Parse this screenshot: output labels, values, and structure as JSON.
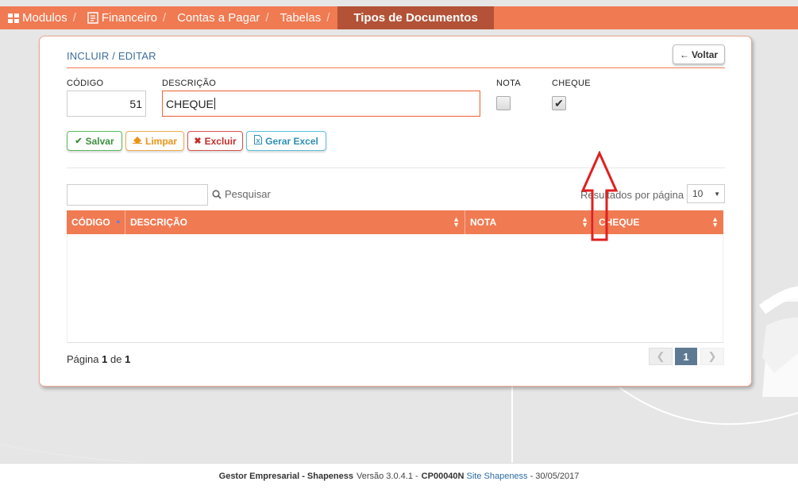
{
  "breadcrumb": {
    "modulos": "Modulos",
    "financeiro": "Financeiro",
    "contas": "Contas a Pagar",
    "tabelas": "Tabelas",
    "current": "Tipos de Documentos",
    "separator": "/"
  },
  "form": {
    "title": "INCLUIR / EDITAR",
    "back_label": "Voltar",
    "codigo_label": "CÓDIGO",
    "codigo_value": "51",
    "descricao_label": "DESCRIÇÃO",
    "descricao_value": "CHEQUE",
    "nota_label": "NOTA",
    "nota_checked": false,
    "cheque_label": "CHEQUE",
    "cheque_checked": true
  },
  "actions": {
    "salvar": "Salvar",
    "limpar": "Limpar",
    "excluir": "Excluir",
    "excel": "Gerar Excel"
  },
  "table": {
    "search_label": "Pesquisar",
    "search_value": "",
    "page_size_label": "Resultados por página",
    "page_size": "10",
    "columns": [
      "CÓDIGO",
      "DESCRIÇÃO",
      "NOTA",
      "CHEQUE"
    ],
    "rows": []
  },
  "pager": {
    "prefix": "Página",
    "page": "1",
    "of": "de",
    "total": "1",
    "current_button": "1"
  },
  "footer": {
    "product": "Gestor Empresarial - Shapeness",
    "version": "Versão 3.0.4.1 -",
    "code": "CP00040N",
    "link": "Site Shapeness",
    "date": "- 30/05/2017"
  },
  "colors": {
    "accent": "#f07a52",
    "breadcrumb_active": "#b35236",
    "annotation_arrow": "#e02020"
  }
}
